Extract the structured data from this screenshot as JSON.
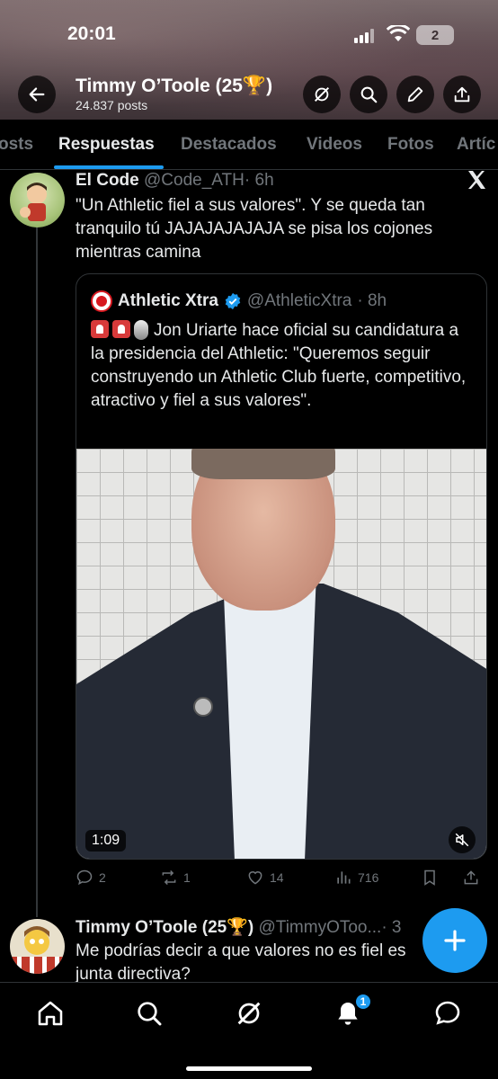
{
  "status_bar": {
    "time": "20:01",
    "battery": "2"
  },
  "header": {
    "name": "Timmy O’Toole (25🏆)",
    "posts": "24.837 posts"
  },
  "tabs": [
    {
      "label": "osts"
    },
    {
      "label": "Respuestas"
    },
    {
      "label": "Destacados"
    },
    {
      "label": "Videos"
    },
    {
      "label": "Fotos"
    },
    {
      "label": "Artíc"
    }
  ],
  "tweet1": {
    "name": "El Code",
    "handle": "@Code_ATH",
    "time": "· 6h",
    "text": "\"Un Athletic fiel a sus valores\". Y se queda tan tranquilo tú JAJAJAJAJAJA se pisa los cojones mientras camina",
    "quote": {
      "name": "Athletic Xtra",
      "handle": "@AthleticXtra",
      "time": "· 8h",
      "text": "Jon Uriarte hace oficial su candidatura a la presidencia del Athletic: \"Queremos seguir construyendo un Athletic Club fuerte, competitivo, atractivo y fiel a sus valores\".",
      "video_time": "1:09"
    },
    "actions": {
      "replies": "2",
      "reposts": "1",
      "likes": "14",
      "views": "716"
    }
  },
  "tweet2": {
    "name": "Timmy O’Toole (25🏆)",
    "handle": "@TimmyOToo...",
    "time": "· 3",
    "text": "Me podrías decir a que valores no es fiel es junta directiva?"
  },
  "notifications_badge": "1",
  "colors": {
    "accent": "#1d9bf0",
    "background": "#000000",
    "muted": "#71767b"
  }
}
